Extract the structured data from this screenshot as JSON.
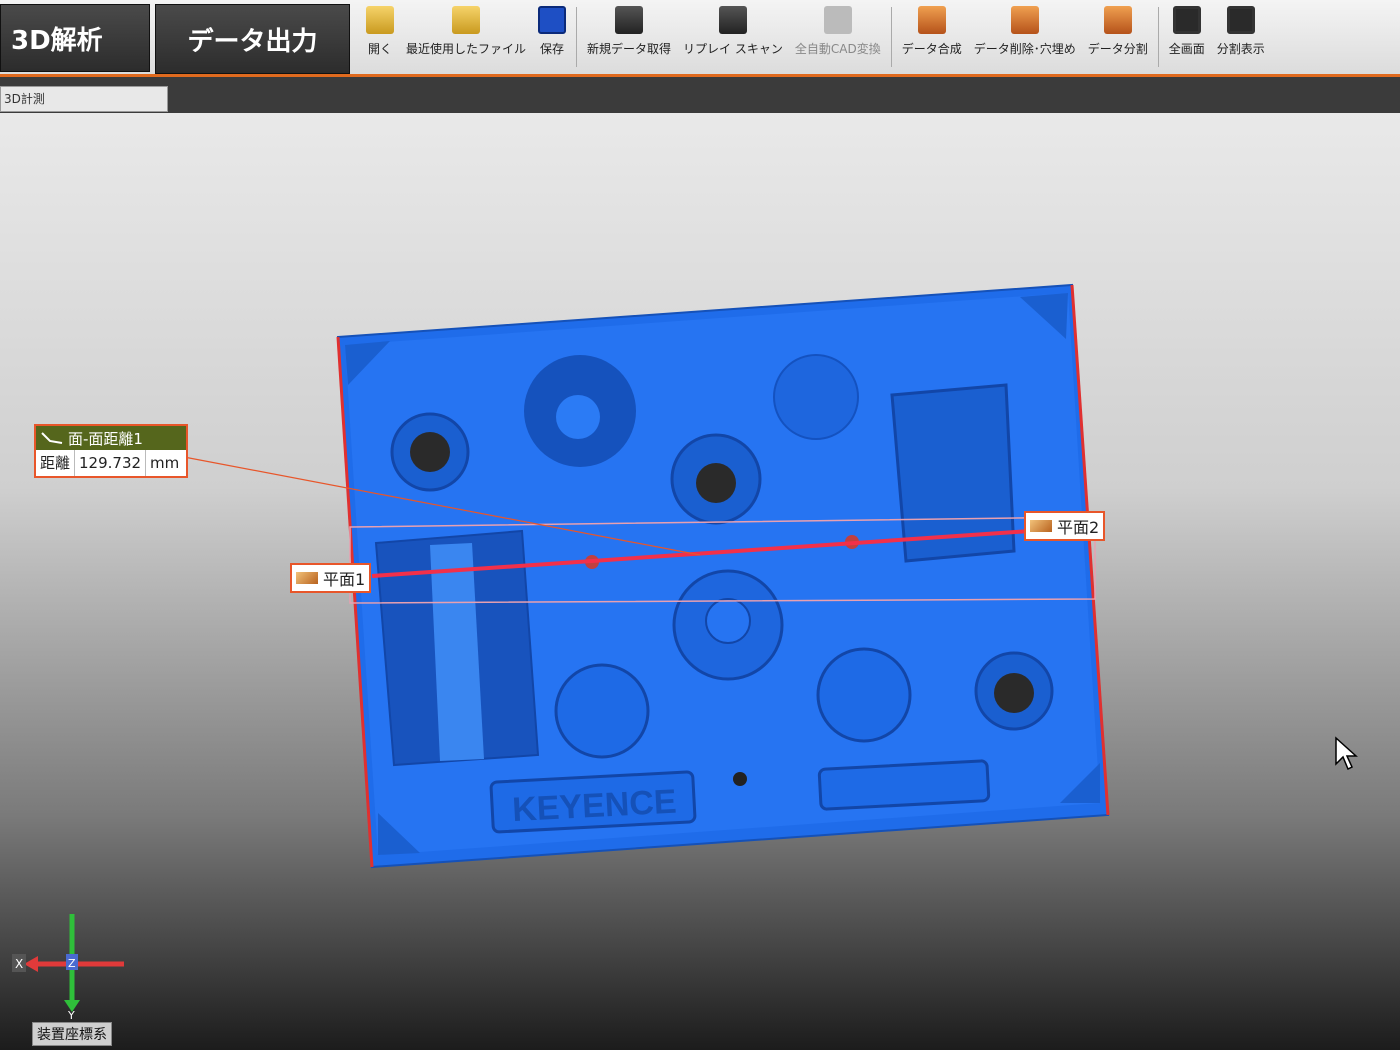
{
  "toolbar": {
    "mode_3d": "3D解析",
    "mode_export": "データ出力",
    "tools": [
      {
        "label": "開く",
        "icon": "folder-open-icon",
        "dim": false
      },
      {
        "label": "最近使用したファイル",
        "icon": "recent-files-icon",
        "dim": false
      },
      {
        "label": "保存",
        "icon": "save-icon",
        "dim": false
      },
      {
        "label": "新規データ取得",
        "icon": "new-scan-icon",
        "dim": false
      },
      {
        "label": "リプレイ スキャン",
        "icon": "replay-scan-icon",
        "dim": false
      },
      {
        "label": "全自動CAD変換",
        "icon": "cad-convert-icon",
        "dim": true
      },
      {
        "label": "データ合成",
        "icon": "data-merge-icon",
        "dim": false
      },
      {
        "label": "データ削除･穴埋め",
        "icon": "data-delete-icon",
        "dim": false
      },
      {
        "label": "データ分割",
        "icon": "data-split-icon",
        "dim": false
      },
      {
        "label": "全画面",
        "icon": "fullscreen-icon",
        "dim": false
      },
      {
        "label": "分割表示",
        "icon": "split-view-icon",
        "dim": false
      }
    ]
  },
  "tabs": {
    "active": "3D計測"
  },
  "measurement": {
    "title": "面-面距離1",
    "field": "距離",
    "value": "129.732",
    "unit": "mm"
  },
  "planes": {
    "plane1": "平面1",
    "plane2": "平面2"
  },
  "part": {
    "logo_text": "KEYENCE",
    "color": "#1e6fe8"
  },
  "coord": {
    "label": "装置座標系",
    "x": "X",
    "y": "Y",
    "z": "Z"
  }
}
